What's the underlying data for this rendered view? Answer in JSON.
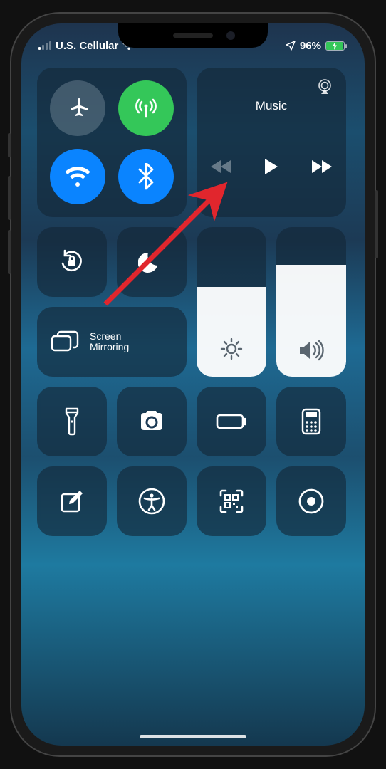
{
  "status": {
    "carrier": "U.S. Cellular",
    "battery_pct": "96%",
    "battery_level": 0.96
  },
  "connectivity": {
    "airplane": false,
    "cellular": true,
    "wifi": true,
    "bluetooth": true
  },
  "music": {
    "title": "Music"
  },
  "toggles": {
    "rotation_lock": true,
    "dnd": true
  },
  "mirror": {
    "line1": "Screen",
    "line2": "Mirroring"
  },
  "sliders": {
    "brightness": 0.6,
    "volume": 0.75
  },
  "shortcuts": {
    "row1": [
      "flashlight",
      "camera",
      "low-power",
      "calculator"
    ],
    "row2": [
      "notes",
      "accessibility",
      "qr-scan",
      "screen-record"
    ]
  },
  "annotation": {
    "kind": "arrow",
    "color": "#e1262d",
    "target": "music-tile"
  }
}
